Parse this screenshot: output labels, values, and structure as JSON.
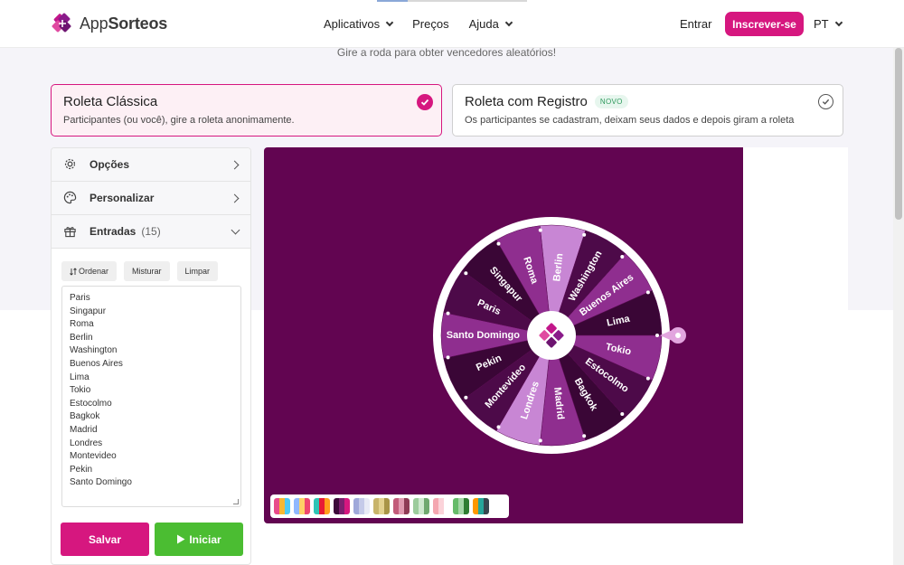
{
  "header": {
    "logo_prefix": "App",
    "logo_suffix": "Sorteos",
    "nav": [
      {
        "label": "Aplicativos",
        "dropdown": true
      },
      {
        "label": "Preços",
        "dropdown": false
      },
      {
        "label": "Ajuda",
        "dropdown": true
      }
    ],
    "login": "Entrar",
    "signup": "Inscrever-se",
    "language": "PT",
    "accent": "#d6177f"
  },
  "subtitle": "Gire a roda para obter vencedores aleatórios!",
  "modes": {
    "classic": {
      "title": "Roleta Clássica",
      "desc": "Participantes (ou você), gire a roleta anonimamente.",
      "selected": true
    },
    "registro": {
      "title": "Roleta com Registro",
      "badge": "NOVO",
      "desc": "Os participantes se cadastram, deixam seus dados e depois giram a roleta",
      "selected": false
    }
  },
  "sidebar": {
    "options": "Opções",
    "customize": "Personalizar",
    "entries_label": "Entradas",
    "entries_count": "(15)",
    "sort": "Ordenar",
    "shuffle": "Misturar",
    "clear": "Limpar",
    "entries": [
      "Paris",
      "Singapur",
      "Roma",
      "Berlin",
      "Washington",
      "Buenos Aires",
      "Lima",
      "Tokio",
      "Estocolmo",
      "Bagkok",
      "Madrid",
      "Londres",
      "Montevideo",
      "Pekin",
      "Santo Domingo"
    ],
    "save": "Salvar",
    "start": "Iniciar"
  },
  "wheel": {
    "background": "#620551",
    "segment_colors": [
      "#3a0636",
      "#4d0a49",
      "#8f2e8f",
      "#c886d4"
    ],
    "pointer_color": "#e2a6df",
    "labels": [
      "Berlin",
      "Washington",
      "Buenos Aires",
      "Lima",
      "Tokio",
      "Estocolmo",
      "Bagkok",
      "Madrid",
      "Londres",
      "Montevideo",
      "Pekin",
      "Santo Domingo",
      "Paris",
      "Singapur",
      "Roma"
    ]
  },
  "palettes": [
    [
      "#e84b8a",
      "#f7b733",
      "#4dc9f6"
    ],
    [
      "#8fb8ff",
      "#ffd166",
      "#ef476f"
    ],
    [
      "#2ec4b6",
      "#e71d36",
      "#ff9f1c"
    ],
    [
      "#3d0a3a",
      "#7b1f6f",
      "#d6177f"
    ],
    [
      "#9fa8da",
      "#c5cae9",
      "#e8eaf6"
    ],
    [
      "#c8b46a",
      "#e3d28f",
      "#a89547"
    ],
    [
      "#c25b7a",
      "#e09ab0",
      "#8e3b55"
    ],
    [
      "#9ccc9c",
      "#cfe8cf",
      "#6fa86f"
    ],
    [
      "#f4a6b0",
      "#fbd3d9",
      "#ffffff"
    ],
    [
      "#66bb6a",
      "#a5d6a7",
      "#2e7d32"
    ],
    [
      "#ff9800",
      "#26a69a",
      "#37474f"
    ]
  ]
}
